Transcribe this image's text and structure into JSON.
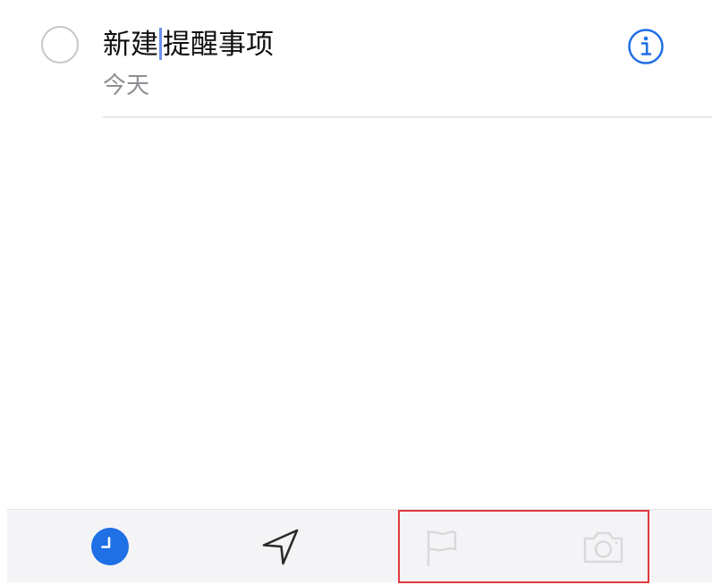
{
  "reminder": {
    "title_before_cursor": "新建",
    "title_after_cursor": "提醒事项",
    "date": "今天"
  },
  "colors": {
    "accent": "#1f6fe5",
    "toolbar_bg": "#f4f4f6",
    "highlight_box": "#e0393e",
    "disabled_icon": "#d9d9db",
    "secondary_text": "#8e8e93"
  },
  "icons": {
    "complete": "empty-circle",
    "info": "info-icon",
    "toolbar": [
      "clock-icon",
      "location-arrow-icon",
      "flag-icon",
      "camera-icon"
    ]
  },
  "toolbar_states": {
    "clock": "active",
    "location": "enabled",
    "flag": "disabled",
    "camera": "disabled"
  }
}
